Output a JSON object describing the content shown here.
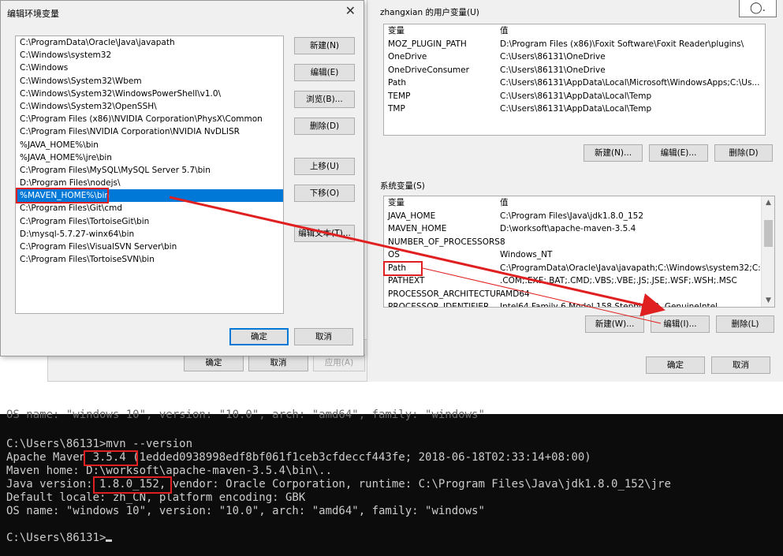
{
  "edit_dialog": {
    "title": "编辑环境变量",
    "close": "✕",
    "path_entries": [
      "C:\\ProgramData\\Oracle\\Java\\javapath",
      "C:\\Windows\\system32",
      "C:\\Windows",
      "C:\\Windows\\System32\\Wbem",
      "C:\\Windows\\System32\\WindowsPowerShell\\v1.0\\",
      "C:\\Windows\\System32\\OpenSSH\\",
      "C:\\Program Files (x86)\\NVIDIA Corporation\\PhysX\\Common",
      "C:\\Program Files\\NVIDIA Corporation\\NVIDIA NvDLISR",
      "%JAVA_HOME%\\bin",
      "%JAVA_HOME%\\jre\\bin",
      "C:\\Program Files\\MySQL\\MySQL Server 5.7\\bin",
      "D:\\Program Files\\nodejs\\",
      "%MAVEN_HOME%\\bin",
      "C:\\Program Files\\Git\\cmd",
      "C:\\Program Files\\TortoiseGit\\bin",
      "D:\\mysql-5.7.27-winx64\\bin",
      "C:\\Program Files\\VisualSVN Server\\bin",
      "C:\\Program Files\\TortoiseSVN\\bin"
    ],
    "selected_index": 12,
    "buttons": {
      "new": "新建(N)",
      "edit": "编辑(E)",
      "browse": "浏览(B)...",
      "delete": "删除(D)",
      "move_up": "上移(U)",
      "move_down": "下移(O)",
      "edit_text": "编辑文本(T)...",
      "ok": "确定",
      "cancel": "取消"
    }
  },
  "background_dialog": {
    "ok": "确定",
    "cancel": "取消",
    "apply": "应用(A)"
  },
  "env_dialog": {
    "help_icon": "◯.",
    "user_group_label": "zhangxian 的用户变量(U)",
    "col_var": "变量",
    "col_val": "值",
    "user_vars": [
      {
        "name": "MOZ_PLUGIN_PATH",
        "value": "D:\\Program Files (x86)\\Foxit Software\\Foxit Reader\\plugins\\"
      },
      {
        "name": "OneDrive",
        "value": "C:\\Users\\86131\\OneDrive"
      },
      {
        "name": "OneDriveConsumer",
        "value": "C:\\Users\\86131\\OneDrive"
      },
      {
        "name": "Path",
        "value": "C:\\Users\\86131\\AppData\\Local\\Microsoft\\WindowsApps;C:\\Us..."
      },
      {
        "name": "TEMP",
        "value": "C:\\Users\\86131\\AppData\\Local\\Temp"
      },
      {
        "name": "TMP",
        "value": "C:\\Users\\86131\\AppData\\Local\\Temp"
      }
    ],
    "user_buttons": {
      "new": "新建(N)...",
      "edit": "编辑(E)...",
      "delete": "删除(D)"
    },
    "system_group_label": "系统变量(S)",
    "system_vars": [
      {
        "name": "JAVA_HOME",
        "value": "C:\\Program Files\\Java\\jdk1.8.0_152"
      },
      {
        "name": "MAVEN_HOME",
        "value": "D:\\worksoft\\apache-maven-3.5.4"
      },
      {
        "name": "NUMBER_OF_PROCESSORS",
        "value": "8"
      },
      {
        "name": "OS",
        "value": "Windows_NT"
      },
      {
        "name": "Path",
        "value": "C:\\ProgramData\\Oracle\\Java\\javapath;C:\\Windows\\system32;C:\\..."
      },
      {
        "name": "PATHEXT",
        "value": ".COM;.EXE;.BAT;.CMD;.VBS;.VBE;.JS;.JSE;.WSF;.WSH;.MSC"
      },
      {
        "name": "PROCESSOR_ARCHITECTURE",
        "value": "AMD64"
      },
      {
        "name": "PROCESSOR_IDENTIFIER",
        "value": "Intel64 Family 6 Model 158 Stepping 9, GenuineIntel"
      }
    ],
    "system_buttons": {
      "new": "新建(W)...",
      "edit": "编辑(I)...",
      "delete": "删除(L)"
    },
    "ok": "确定",
    "cancel": "取消"
  },
  "console": {
    "cut_line": "OS name: \"windows 10\", version: \"10.0\", arch: \"amd64\", family: \"windows\"",
    "prompt1": "C:\\Users\\86131>mvn --version",
    "line_maven": "Apache Maven 3.5.4 (1edded0938998edf8bf061f1ceb3cfdeccf443fe; 2018-06-18T02:33:14+08:00)",
    "line_home": "Maven home: D:\\worksoft\\apache-maven-3.5.4\\bin\\..",
    "line_java": "Java version: 1.8.0_152, vendor: Oracle Corporation, runtime: C:\\Program Files\\Java\\jdk1.8.0_152\\jre",
    "line_locale": "Default locale: zh_CN, platform encoding: GBK",
    "line_os": "OS name: \"windows 10\", version: \"10.0\", arch: \"amd64\", family: \"windows\"",
    "prompt2": "C:\\Users\\86131>"
  },
  "colors": {
    "highlight": "#e02020",
    "selection": "#0078d7",
    "console_bg": "#0c0c0c"
  }
}
